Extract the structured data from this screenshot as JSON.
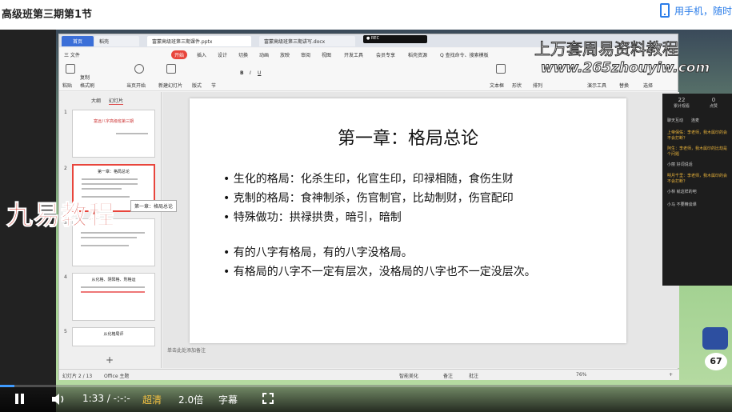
{
  "page": {
    "course_title": "高级班第三期第1节",
    "mobile_link": "用手机，随时"
  },
  "wps": {
    "tabs": [
      "首页",
      "稻壳",
      "富蒙高级班第三期课件.pptx",
      "富蒙高级班第三期讲写.docx"
    ],
    "menu": [
      "三 文件",
      "开始",
      "插入",
      "设计",
      "切换",
      "动画",
      "放映",
      "审阅",
      "视图",
      "开发工具",
      "会员专享",
      "稻壳资源",
      "Q 查找命令、搜索模板"
    ],
    "menu_active": "开始",
    "toolbar": [
      "粘贴",
      "复制",
      "格式刷",
      "当页开始",
      "新建幻灯片",
      "版式",
      "节",
      "文本框",
      "形状",
      "排列",
      "演示工具",
      "替换",
      "选择"
    ],
    "panel_tabs": [
      "大纲",
      "幻灯片"
    ],
    "thumbs": [
      {
        "num": "1",
        "title": "富远八字高级班第三期"
      },
      {
        "num": "2",
        "title": "第一章：格局总论"
      },
      {
        "num": "3",
        "title": ""
      },
      {
        "num": "4",
        "title": "从化格、阴阳格、刑格运"
      },
      {
        "num": "5",
        "title": "从化格局评"
      }
    ],
    "notes_placeholder": "单击此处添加备注",
    "status": {
      "slide_index": "幻灯片 2 / 13",
      "theme": "Office 主题",
      "smart_beautify": "智能美化",
      "notes": "备注",
      "comments": "批注",
      "zoom": "76%"
    },
    "tooltip": "第一章：格局总论"
  },
  "slide": {
    "title": "第一章：格局总论",
    "bullets": [
      "• 生化的格局：化杀生印，化官生印，印禄相随，食伤生财",
      "• 克制的格局：食神制杀，伤官制官，比劫制财，伤官配印",
      "• 特殊做功：拱禄拱贵，暗引，暗制",
      "• 有的八字有格局，有的八字没格局。",
      "• 有格局的八字不一定有层次，没格局的八字也不一定没层次。"
    ]
  },
  "watermarks": {
    "line1": "上万套周易资料教程",
    "line2": "www.265zhouyiw.com",
    "brand": "九易教程"
  },
  "chat": {
    "stats": [
      {
        "value": "22",
        "label": "累计观看"
      },
      {
        "value": "0",
        "label": "点赞"
      }
    ],
    "tabs": [
      "聊天互动",
      "连麦"
    ],
    "messages": [
      "上帝保佑：李老师，我木属印的会不会打断？",
      "阿生：李老师，我木属印的比劫是个问题",
      "小丽 好词说话",
      "明月千里：李老师，我木属印的会不会打断？",
      "小林 就这样的吧",
      "小马 不要精谈课"
    ],
    "timer": "67"
  },
  "player": {
    "time": "1:33 / -:-:-",
    "quality": "超清",
    "speed": "2.0倍",
    "subtitle": "字幕",
    "progress": 0.02
  },
  "colors": {
    "accent": "#e8453c",
    "wps_home": "#3b6fd8",
    "progress": "#3f9bff"
  }
}
